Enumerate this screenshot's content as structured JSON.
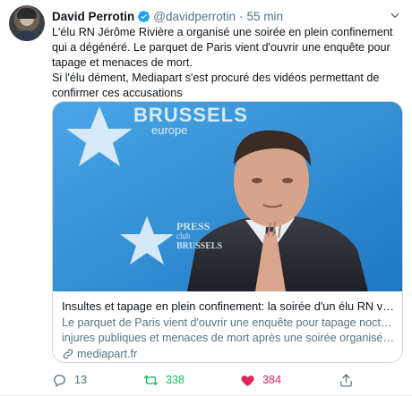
{
  "author": {
    "name": "David Perrotin",
    "handle": "@davidperrotin",
    "separator": "·",
    "time": "55 min"
  },
  "tweet": {
    "para1": "L'élu RN Jérôme Rivière a organisé une soirée en plein confinement qui a dégénéré. Le parquet de Paris vient d'ouvrir une enquête pour tapage et menaces de mort.",
    "para2": "Si l'élu dément, Mediapart s'est procuré des vidéos permettant de confirmer ces accusations"
  },
  "card": {
    "image_text_top": "BRUSSELS",
    "image_text_top_sub": "europe",
    "image_text_bottom": "PRESS",
    "image_text_bottom_2": "club",
    "image_text_bottom_3": "BRUSSELS",
    "title": "Insultes et tapage en plein confinement: la soirée d'un élu RN visée par l...",
    "desc_line1": "Le parquet de Paris vient d'ouvrir une enquête pour tapage nocturne,",
    "desc_line2": "injures publiques et menaces de mort après une soirée organisée en ple...",
    "domain": "mediapart.fr"
  },
  "actions": {
    "reply_count": "13",
    "retweet_count": "338",
    "like_count": "384"
  },
  "colors": {
    "verified": "#1da1f2",
    "retweet_active": "#17bf63",
    "like_active": "#e0245e",
    "muted": "#5b7083"
  }
}
